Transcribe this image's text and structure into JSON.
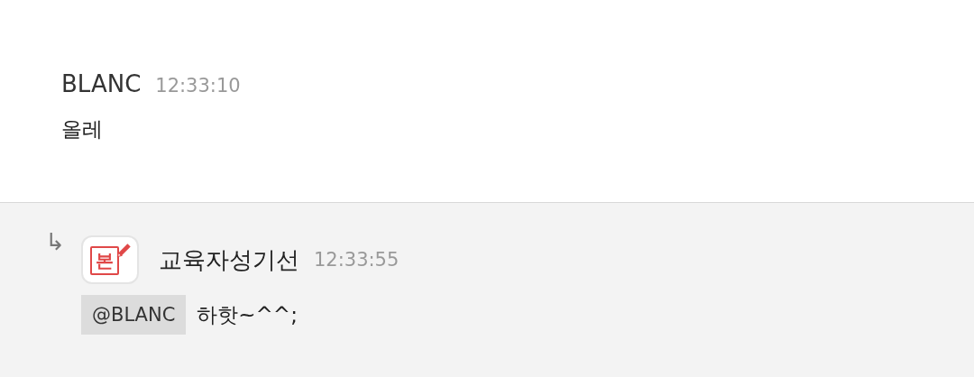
{
  "message": {
    "author": "BLANC",
    "time": "12:33:10",
    "text": "올레"
  },
  "reply": {
    "arrow": "↳",
    "avatar_text": "본",
    "author": "교육자성기선",
    "time": "12:33:55",
    "mention": "@BLANC",
    "text": "하핫~^^;"
  }
}
